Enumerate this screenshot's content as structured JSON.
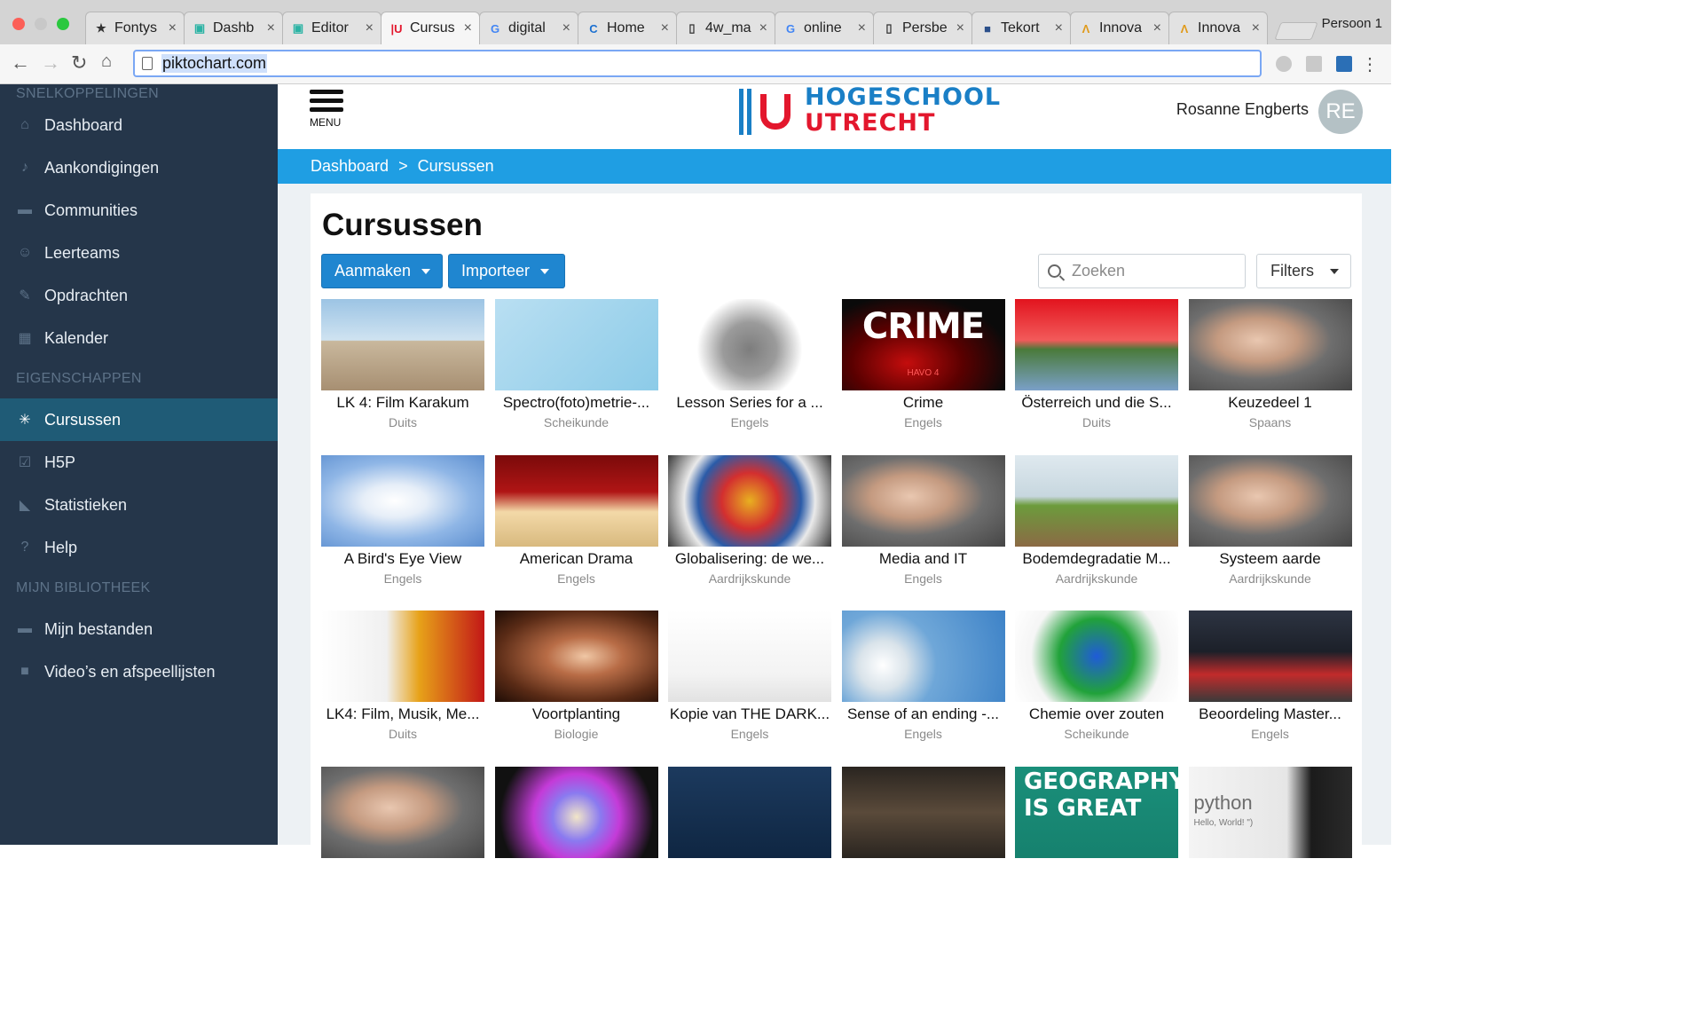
{
  "browser": {
    "tabs": [
      {
        "title": "Fontys",
        "icon": "fontys-icon"
      },
      {
        "title": "Dashb",
        "icon": "dashboard-icon"
      },
      {
        "title": "Editor",
        "icon": "dashboard-icon"
      },
      {
        "title": "Cursus",
        "icon": "hu-icon",
        "active": true
      },
      {
        "title": "digital",
        "icon": "google-icon"
      },
      {
        "title": "Home",
        "icon": "c-icon"
      },
      {
        "title": "4w_ma",
        "icon": "document-icon"
      },
      {
        "title": "online",
        "icon": "google-icon"
      },
      {
        "title": "Persbe",
        "icon": "document-icon"
      },
      {
        "title": "Tekort",
        "icon": "news-icon"
      },
      {
        "title": "Innova",
        "icon": "innova-icon"
      },
      {
        "title": "Innova",
        "icon": "innova-icon"
      }
    ],
    "profile": "Persoon 1",
    "url": "piktochart.com"
  },
  "sidebar": {
    "sections": [
      {
        "title": "SNELKOPPELINGEN",
        "items": [
          {
            "label": "Dashboard",
            "icon": "home-icon"
          },
          {
            "label": "Aankondigingen",
            "icon": "bell-icon"
          },
          {
            "label": "Communities",
            "icon": "chat-bubble-icon"
          },
          {
            "label": "Leerteams",
            "icon": "users-icon"
          },
          {
            "label": "Opdrachten",
            "icon": "pencil-icon"
          },
          {
            "label": "Kalender",
            "icon": "calendar-icon"
          }
        ]
      },
      {
        "title": "EIGENSCHAPPEN",
        "items": [
          {
            "label": "Cursussen",
            "icon": "share-icon",
            "active": true
          },
          {
            "label": "H5P",
            "icon": "checkbox-icon"
          },
          {
            "label": "Statistieken",
            "icon": "area-chart-icon"
          },
          {
            "label": "Help",
            "icon": "question-icon"
          }
        ]
      },
      {
        "title": "MIJN BIBLIOTHEEK",
        "items": [
          {
            "label": "Mijn bestanden",
            "icon": "folder-icon"
          },
          {
            "label": "Video’s en afspeellijsten",
            "icon": "video-camera-icon"
          }
        ]
      }
    ]
  },
  "header": {
    "menu_label": "MENU",
    "logo_line1": "HOGESCHOOL",
    "logo_line2": "UTRECHT",
    "user_name": "Rosanne Engberts",
    "avatar_initials": "RE"
  },
  "breadcrumb": {
    "items": [
      "Dashboard",
      "Cursussen"
    ],
    "separator": ">"
  },
  "main": {
    "title": "Cursussen",
    "create_label": "Aanmaken",
    "import_label": "Importeer",
    "search_placeholder": "Zoeken",
    "filters_label": "Filters",
    "courses": [
      {
        "title": "LK 4: Film Karakum",
        "subject": "Duits",
        "thumb": "desert"
      },
      {
        "title": "Spectro(foto)metrie-...",
        "subject": "Scheikunde",
        "thumb": "spectro"
      },
      {
        "title": "Lesson Series for a ...",
        "subject": "Engels",
        "thumb": "puzzle"
      },
      {
        "title": "Crime",
        "subject": "Engels",
        "thumb": "crime",
        "thumb_text": "CRIME",
        "thumb_subtext": "HAVO 4"
      },
      {
        "title": "Österreich und die S...",
        "subject": "Duits",
        "thumb": "austria"
      },
      {
        "title": "Keuzedeel 1",
        "subject": "Spaans",
        "thumb": "kid"
      },
      {
        "title": "A Bird's Eye View",
        "subject": "Engels",
        "thumb": "dove"
      },
      {
        "title": "American Drama",
        "subject": "Engels",
        "thumb": "stage"
      },
      {
        "title": "Globalisering: de we...",
        "subject": "Aardrijkskunde",
        "thumb": "mosaic"
      },
      {
        "title": "Media and IT",
        "subject": "Engels",
        "thumb": "kid"
      },
      {
        "title": "Bodemdegradatie M...",
        "subject": "Aardrijkskunde",
        "thumb": "soil"
      },
      {
        "title": "Systeem aarde",
        "subject": "Aardrijkskunde",
        "thumb": "kid"
      },
      {
        "title": "LK4: Film, Musik, Me...",
        "subject": "Duits",
        "thumb": "newspapers"
      },
      {
        "title": "Voortplanting",
        "subject": "Biologie",
        "thumb": "embryo"
      },
      {
        "title": "Kopie van THE DARK...",
        "subject": "Engels",
        "thumb": "desk"
      },
      {
        "title": "Sense of an ending -...",
        "subject": "Engels",
        "thumb": "dandelion"
      },
      {
        "title": "Chemie over zouten",
        "subject": "Scheikunde",
        "thumb": "molecule"
      },
      {
        "title": "Beoordeling Master...",
        "subject": "Engels",
        "thumb": "traffic"
      },
      {
        "title": "",
        "subject": "",
        "thumb": "kid"
      },
      {
        "title": "",
        "subject": "",
        "thumb": "sphere"
      },
      {
        "title": "",
        "subject": "",
        "thumb": "chalkboard"
      },
      {
        "title": "",
        "subject": "",
        "thumb": "group"
      },
      {
        "title": "",
        "subject": "",
        "thumb": "geography",
        "thumb_text": "GEOGRAPHY IS GREAT"
      },
      {
        "title": "",
        "subject": "",
        "thumb": "python",
        "thumb_text": "python",
        "thumb_subtext": "Hello, World! \")"
      }
    ]
  },
  "colors": {
    "sidebar_bg": "#25364a",
    "sidebar_active": "#1f5b76",
    "breadcrumb_bg": "#1f9ee3",
    "primary_button": "#1f86d0",
    "logo_blue": "#1a7fc6",
    "logo_red": "#e3172d"
  }
}
